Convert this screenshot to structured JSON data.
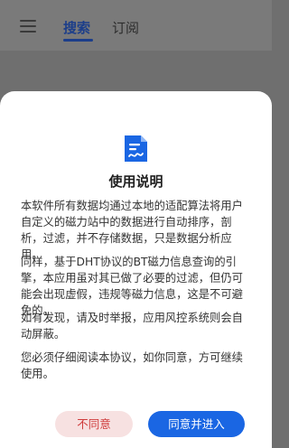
{
  "colors": {
    "accent": "#1c3e8a",
    "primary_button": "#1a66e3",
    "secondary_button_bg": "#f7e1e1",
    "secondary_button_text": "#cf3b3b"
  },
  "header": {
    "menu_icon": "hamburger-menu-icon",
    "tabs": [
      {
        "label": "搜索",
        "active": true
      },
      {
        "label": "订阅",
        "active": false
      }
    ]
  },
  "dialog": {
    "icon": "document-signature-icon",
    "title": "使用说明",
    "paragraphs": [
      "本软件所有数据均通过本地的适配算法将用户自定义的磁力站中的数据进行自动排序，剖析，过滤，并不存储数据，只是数据分析应用。",
      "同样，基于DHT协议的BT磁力信息查询的引擎，本应用虽对其已做了必要的过滤，但仍可能会出现虚假，违规等磁力信息，这是不可避免的。",
      "如有发现，请及时举报，应用风控系统则会自动屏蔽。",
      "您必须仔细阅读本协议，如你同意，方可继续使用。"
    ],
    "disagree_label": "不同意",
    "agree_label": "同意并进入"
  }
}
